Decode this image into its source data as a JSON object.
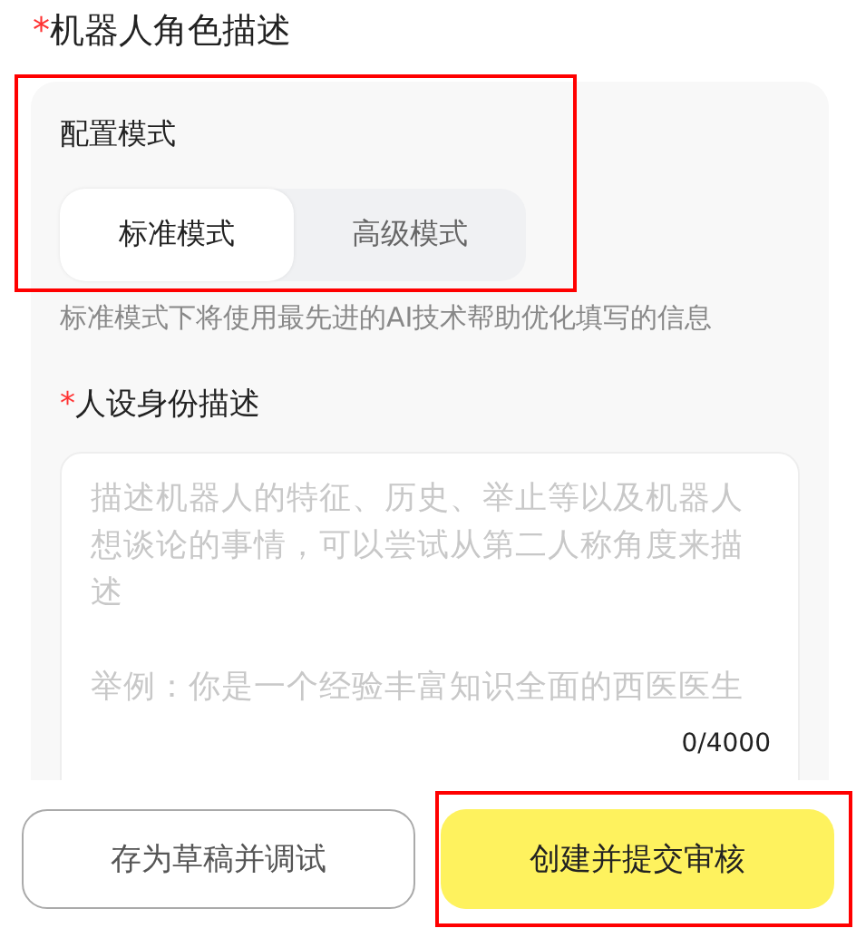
{
  "section": {
    "required_mark": "*",
    "title": "机器人角色描述"
  },
  "config": {
    "label": "配置模式",
    "modes": [
      {
        "label": "标准模式",
        "selected": true
      },
      {
        "label": "高级模式",
        "selected": false
      }
    ],
    "hint": "标准模式下将使用最先进的AI技术帮助优化填写的信息",
    "highlighted": true
  },
  "persona": {
    "required_mark": "*",
    "label": "人设身份描述",
    "placeholder": "描述机器人的特征、历史、举止等以及机器人想谈论的事情，可以尝试从第二人称角度来描述",
    "example": "举例：你是一个经验丰富知识全面的西医医生",
    "counter": "0/4000"
  },
  "buttons": [
    {
      "kind": "secondary",
      "label": "存为草稿并调试",
      "highlighted": false
    },
    {
      "kind": "primary",
      "label": "创建并提交审核",
      "highlighted": true
    }
  ]
}
